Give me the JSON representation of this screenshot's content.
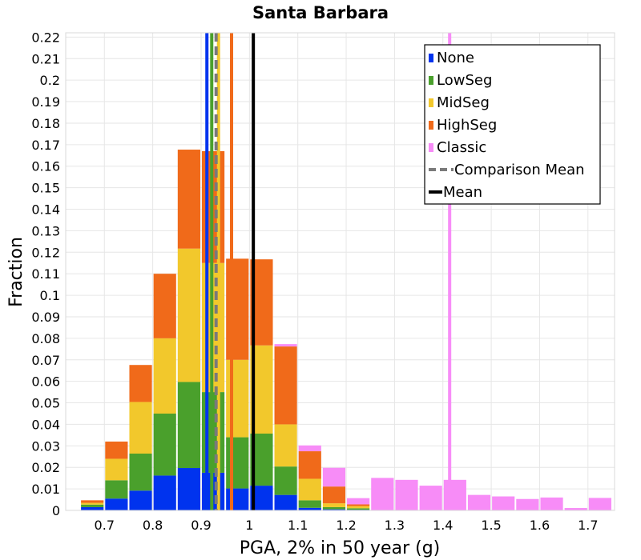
{
  "chart_data": {
    "type": "bar",
    "stacked": true,
    "title": "Santa Barbara",
    "xlabel": "PGA, 2% in 50 year (g)",
    "ylabel": "Fraction",
    "xlim": [
      0.62,
      1.755
    ],
    "ylim": [
      0,
      0.222
    ],
    "grid": true,
    "legend_position": "top-right",
    "x_ticks": [
      "0.7",
      "0.8",
      "0.9",
      "1",
      "1.1",
      "1.2",
      "1.3",
      "1.4",
      "1.5",
      "1.6",
      "1.7"
    ],
    "y_ticks": [
      "0",
      "0.01",
      "0.02",
      "0.03",
      "0.04",
      "0.05",
      "0.06",
      "0.07",
      "0.08",
      "0.09",
      "0.1",
      "0.11",
      "0.12",
      "0.13",
      "0.14",
      "0.15",
      "0.16",
      "0.17",
      "0.18",
      "0.19",
      "0.2",
      "0.21",
      "0.22"
    ],
    "bin_width": 0.05,
    "bins": [
      0.675,
      0.725,
      0.775,
      0.825,
      0.875,
      0.925,
      0.975,
      1.025,
      1.075,
      1.125,
      1.175,
      1.225
    ],
    "series": [
      {
        "name": "None",
        "color": "#0033ee",
        "values": [
          0.0015,
          0.0055,
          0.0092,
          0.0162,
          0.0197,
          0.0175,
          0.0102,
          0.0115,
          0.0072,
          0.0012,
          0.0005,
          0.0003
        ]
      },
      {
        "name": "LowSeg",
        "color": "#4aa02c",
        "values": [
          0.0012,
          0.0085,
          0.0172,
          0.0288,
          0.04,
          0.0375,
          0.0238,
          0.0242,
          0.0132,
          0.0035,
          0.001,
          0.0007
        ]
      },
      {
        "name": "MidSeg",
        "color": "#f2c82c",
        "values": [
          0.0008,
          0.01,
          0.024,
          0.035,
          0.062,
          0.06,
          0.036,
          0.041,
          0.0196,
          0.01,
          0.0018,
          0.001
        ]
      },
      {
        "name": "HighSeg",
        "color": "#f06a1a",
        "values": [
          0.0012,
          0.008,
          0.0172,
          0.03,
          0.046,
          0.052,
          0.047,
          0.04,
          0.0362,
          0.0128,
          0.0078,
          0.0008
        ]
      }
    ],
    "classic": {
      "name": "Classic",
      "color": "#f78cf7",
      "bins": [
        1.075,
        1.125,
        1.175,
        1.225,
        1.275,
        1.325,
        1.375,
        1.425,
        1.475,
        1.525,
        1.575,
        1.625,
        1.675,
        1.725
      ],
      "values": [
        0.0773,
        0.0302,
        0.0198,
        0.0057,
        0.0151,
        0.0142,
        0.0115,
        0.0142,
        0.0072,
        0.0065,
        0.0053,
        0.006,
        0.0011,
        0.0058
      ]
    },
    "mean_lines": [
      {
        "name": "None",
        "color": "#0033ee",
        "x": 0.912
      },
      {
        "name": "LowSeg",
        "color": "#4aa02c",
        "x": 0.922
      },
      {
        "name": "MidSeg",
        "color": "#f2c82c",
        "x": 0.936
      },
      {
        "name": "HighSeg",
        "color": "#f06a1a",
        "x": 0.963
      },
      {
        "name": "Classic",
        "color": "#f78cf7",
        "x": 1.414
      }
    ],
    "comparison_mean": {
      "name": "Comparison Mean",
      "color": "#7a7a7a",
      "x": 0.931
    },
    "mean": {
      "name": "Mean",
      "color": "#000000",
      "x": 1.008
    },
    "legend": [
      {
        "label": "None",
        "color": "#0033ee",
        "kind": "box"
      },
      {
        "label": "LowSeg",
        "color": "#4aa02c",
        "kind": "box"
      },
      {
        "label": "MidSeg",
        "color": "#f2c82c",
        "kind": "box"
      },
      {
        "label": "HighSeg",
        "color": "#f06a1a",
        "kind": "box"
      },
      {
        "label": "Classic",
        "color": "#f78cf7",
        "kind": "box"
      },
      {
        "label": "Comparison Mean",
        "color": "#7a7a7a",
        "kind": "dash"
      },
      {
        "label": "Mean",
        "color": "#000000",
        "kind": "line"
      }
    ]
  }
}
